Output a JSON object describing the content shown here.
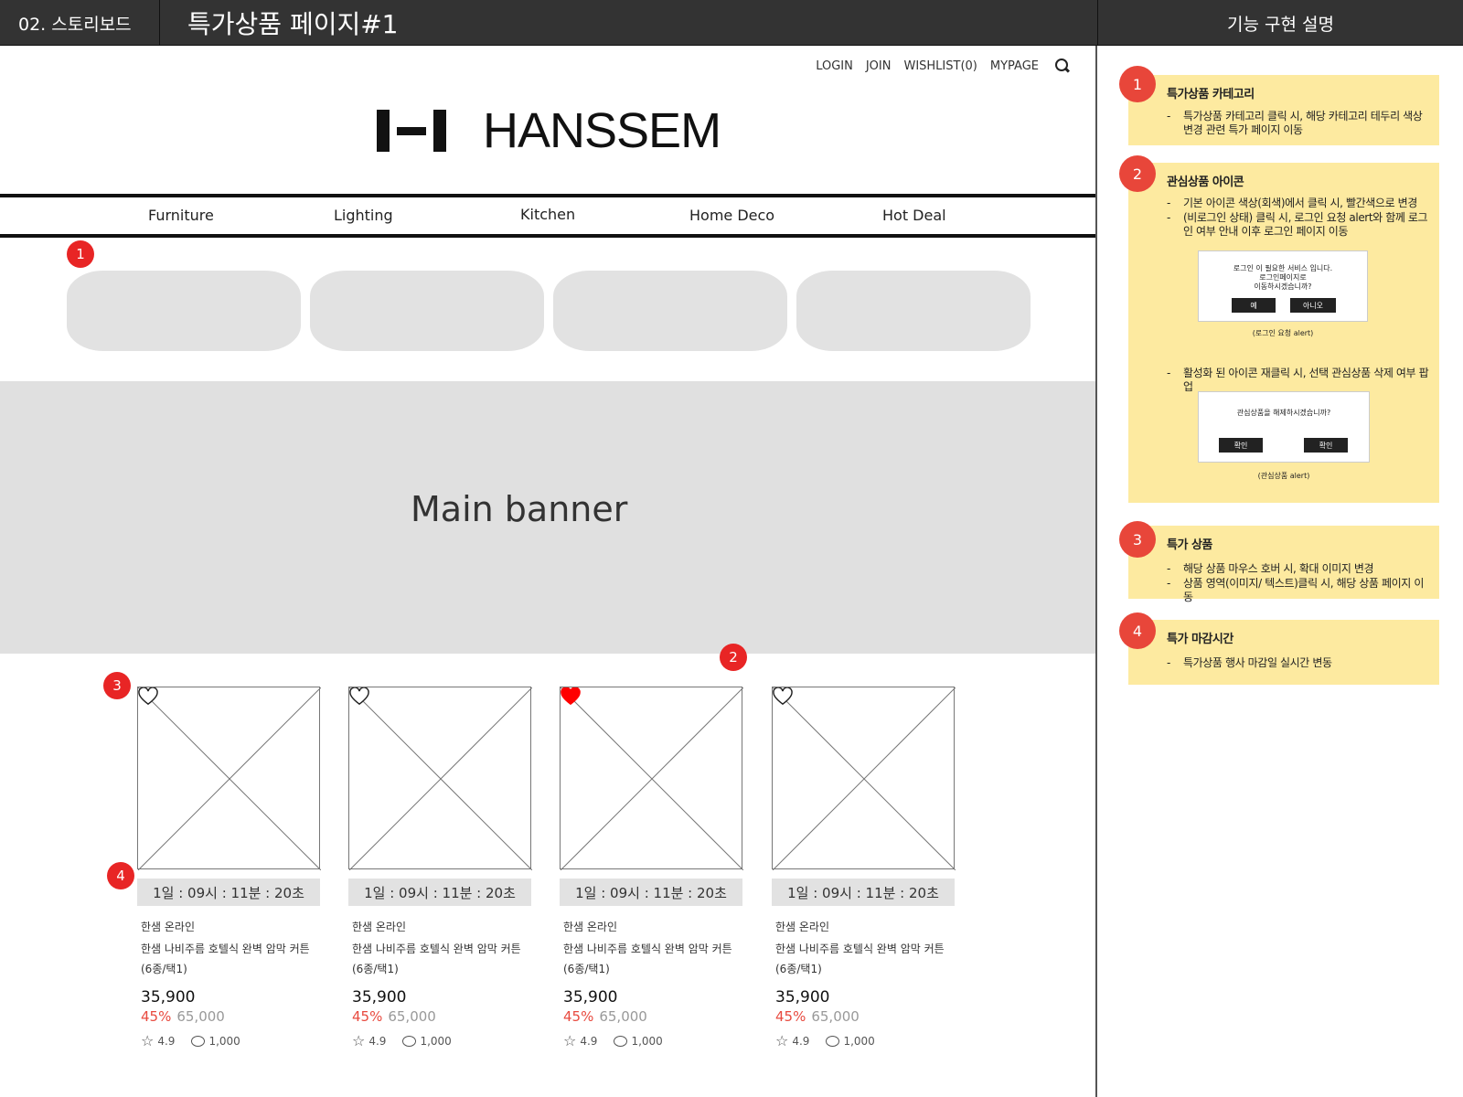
{
  "header": {
    "section": "02. 스토리보드",
    "page_title": "특가상품 페이지#1",
    "panel_title": "기능 구현 설명"
  },
  "util_nav": [
    "LOGIN",
    "JOIN",
    "WISHLIST(0)",
    "MYPAGE"
  ],
  "logo_text": "HANSSEM",
  "gnb": [
    "Furniture",
    "Lighting",
    "Kitchen",
    "Home Deco",
    "Hot Deal"
  ],
  "banner": "Main banner",
  "products": [
    {
      "timer": "1일 : 09시 : 11분 : 20초",
      "brand": "한샘 온라인",
      "name": "한샘 나비주름 호텔식 완벽 암막 커튼(6종/택1)",
      "price": "35,900",
      "discount": "45%",
      "original": "65,000",
      "rating": "4.9",
      "reviews": "1,000",
      "wishlisted": false
    },
    {
      "timer": "1일 : 09시 : 11분 : 20초",
      "brand": "한샘 온라인",
      "name": "한샘 나비주름 호텔식 완벽 암막 커튼(6종/택1)",
      "price": "35,900",
      "discount": "45%",
      "original": "65,000",
      "rating": "4.9",
      "reviews": "1,000",
      "wishlisted": false
    },
    {
      "timer": "1일 : 09시 : 11분 : 20초",
      "brand": "한샘 온라인",
      "name": "한샘 나비주름 호텔식 완벽 암막 커튼(6종/택1)",
      "price": "35,900",
      "discount": "45%",
      "original": "65,000",
      "rating": "4.9",
      "reviews": "1,000",
      "wishlisted": true
    },
    {
      "timer": "1일 : 09시 : 11분 : 20초",
      "brand": "한샘 온라인",
      "name": "한샘 나비주름 호텔식 완벽 암막 커튼(6종/택1)",
      "price": "35,900",
      "discount": "45%",
      "original": "65,000",
      "rating": "4.9",
      "reviews": "1,000",
      "wishlisted": false
    }
  ],
  "markers": [
    "1",
    "2",
    "3",
    "4"
  ],
  "notes": [
    {
      "num": "1",
      "title": "특가상품 카테고리",
      "lines": [
        "특가상품 카테고리 클릭 시, 해당 카테고리 테두리 색상 변경 관련 특가 페이지 이동"
      ]
    },
    {
      "num": "2",
      "title": "관심상품 아이콘",
      "lines": [
        "기본 아이콘 색상(회색)에서 클릭 시, 빨간색으로 변경",
        "(비로그인 상태) 클릭 시, 로그인 요청 alert와 함께 로그인 여부 안내 이후 로그인 페이지 이동",
        "활성화 된 아이콘 재클릭 시, 선택 관심상품 삭제 여부 팝업"
      ]
    },
    {
      "num": "3",
      "title": "특가 상품",
      "lines": [
        "해당 상품 마우스 호버 시, 확대 이미지 변경",
        "상품 영역(이미지/ 텍스트)클릭 시, 해당 상품 페이지 이동"
      ]
    },
    {
      "num": "4",
      "title": "특가 마감시간",
      "lines": [
        "특가상품 행사 마감일 실시간 변동"
      ]
    }
  ],
  "alerts": {
    "login": {
      "text1": "로그인 이 필요한 서비스 입니다.",
      "text2": "로그인페이지로",
      "text3": "이동하시겠습니까?",
      "yes": "예",
      "no": "아니오",
      "caption": "(로그인 요청 alert)"
    },
    "wish": {
      "text": "관심상품을 해제하시겠습니까?",
      "btn1": "확인",
      "btn2": "확인",
      "caption": "(관심상품 alert)"
    }
  },
  "colors": {
    "badge_red": "#e82525",
    "note_yellow": "#fdeaa0",
    "heart_active": "#ff0000",
    "discount": "#e84a3f"
  }
}
